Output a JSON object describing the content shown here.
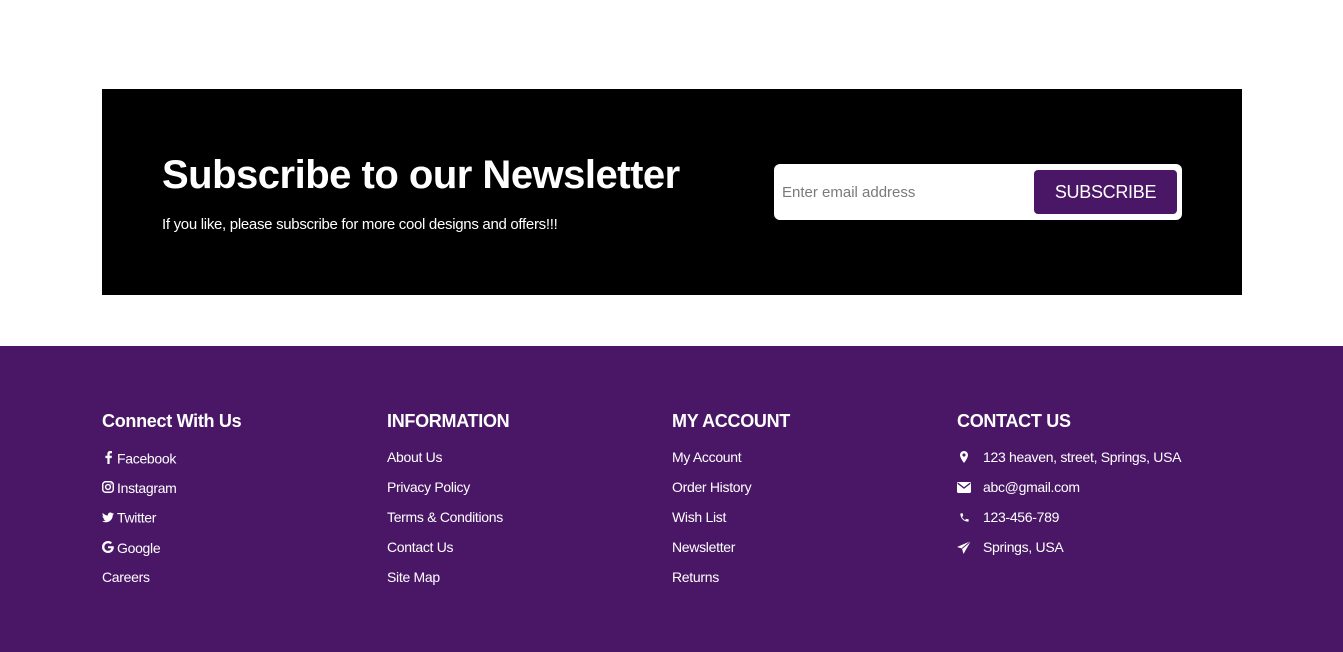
{
  "newsletter": {
    "title": "Subscribe to our Newsletter",
    "subtitle": "If you like, please subscribe for more cool designs and offers!!!",
    "email_placeholder": "Enter email address",
    "button_label": "SUBSCRIBE"
  },
  "footer": {
    "connect": {
      "title": "Connect With Us",
      "items": [
        {
          "label": "Facebook",
          "icon": "facebook-icon"
        },
        {
          "label": "Instagram",
          "icon": "instagram-icon"
        },
        {
          "label": "Twitter",
          "icon": "twitter-icon"
        },
        {
          "label": "Google",
          "icon": "google-icon"
        },
        {
          "label": "Careers",
          "icon": ""
        }
      ]
    },
    "information": {
      "title": "INFORMATION",
      "items": [
        "About Us",
        "Privacy Policy",
        "Terms & Conditions",
        "Contact Us",
        "Site Map"
      ]
    },
    "account": {
      "title": "MY ACCOUNT",
      "items": [
        "My Account",
        "Order History",
        "Wish List",
        "Newsletter",
        "Returns"
      ]
    },
    "contact": {
      "title": "CONTACT US",
      "items": [
        {
          "label": "123 heaven, street, Springs, USA",
          "icon": "map-marker-icon"
        },
        {
          "label": "abc@gmail.com",
          "icon": "envelope-icon"
        },
        {
          "label": "123-456-789",
          "icon": "phone-icon"
        },
        {
          "label": "Springs, USA",
          "icon": "paper-plane-icon"
        }
      ]
    }
  },
  "colors": {
    "brand_purple": "#4a1766",
    "newsletter_bg": "#000000",
    "text_light": "#ffffff"
  }
}
